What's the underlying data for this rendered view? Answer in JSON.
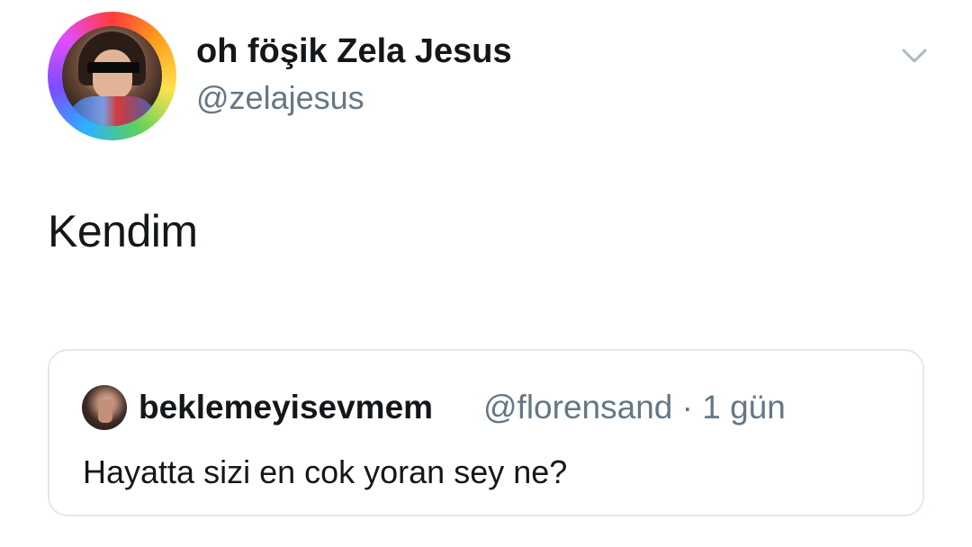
{
  "tweet": {
    "author": {
      "display_name": "oh föşik Zela Jesus",
      "handle": "@zelajesus",
      "avatar_icon": "profile-photo-avatar"
    },
    "text": "Kendim",
    "menu_icon": "chevron-down-icon"
  },
  "quoted_tweet": {
    "author": {
      "display_name": "beklemeyisevmem",
      "handle": "@florensand",
      "avatar_icon": "profile-photo-avatar"
    },
    "separator": "·",
    "time": "1 gün",
    "text": "Hayatta sizi en cok yoran sey ne?"
  },
  "colors": {
    "primary_text": "#14171a",
    "secondary_text": "#657786",
    "border": "#e1e8ed"
  }
}
